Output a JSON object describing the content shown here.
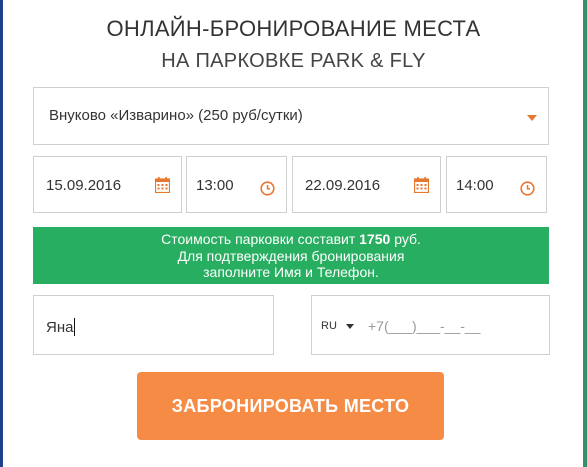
{
  "title": {
    "line1": "ОНЛАЙН-БРОНИРОВАНИЕ МЕСТА",
    "line2": "НА ПАРКОВКЕ PARK & FLY"
  },
  "parking_select": {
    "selected": "Внуково «Изварино» (250 руб/сутки)",
    "icon": "caret-down-icon"
  },
  "arrival": {
    "date": "15.09.2016",
    "date_icon": "calendar-icon",
    "time": "13:00",
    "time_icon": "clock-icon"
  },
  "departure": {
    "date": "22.09.2016",
    "date_icon": "calendar-icon",
    "time": "14:00",
    "time_icon": "clock-icon"
  },
  "notice": {
    "prefix": "Стоимость парковки составит",
    "amount": "1750",
    "suffix": "руб.",
    "line2": "Для подтверждения бронирования",
    "line3": "заполните Имя и Телефон."
  },
  "name_field": {
    "value": "Яна"
  },
  "phone_field": {
    "country": "RU",
    "placeholder": "+7(___)___-__-__"
  },
  "submit": {
    "label": "ЗАБРОНИРОВАТЬ МЕСТО"
  },
  "colors": {
    "accent": "#e8772e",
    "button": "#f68b45",
    "notice_bg": "#27ae60",
    "border": "#cfcfcf"
  }
}
